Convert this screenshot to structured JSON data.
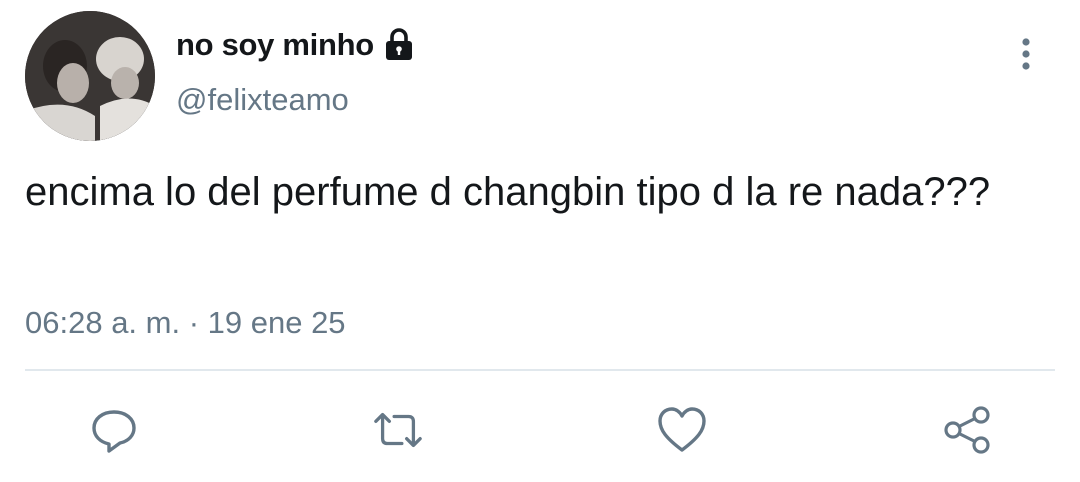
{
  "user": {
    "display_name": "no soy minho",
    "handle": "@felixteamo"
  },
  "tweet": {
    "text": "encima lo del perfume d changbin tipo d la re nada???",
    "timestamp": "06:28 a. m. · 19 ene 25"
  },
  "icons": {
    "lock": "lock-icon",
    "more": "more-vertical-icon",
    "reply": "reply-icon",
    "retweet": "retweet-icon",
    "like": "heart-icon",
    "share": "share-icon"
  },
  "colors": {
    "text": "#14171a",
    "secondary": "#657786",
    "divider": "#e1e8ed"
  }
}
